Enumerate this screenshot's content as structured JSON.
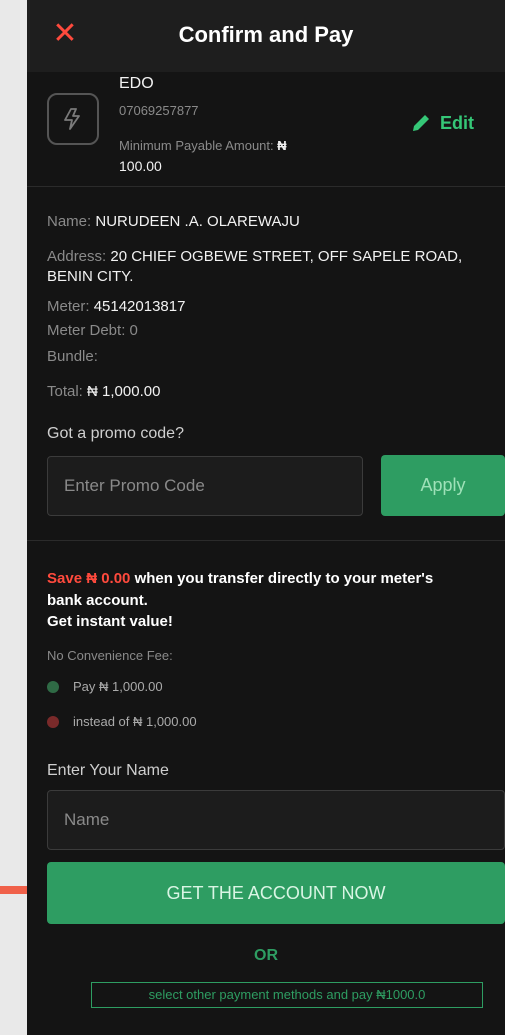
{
  "header": {
    "title": "Confirm and Pay",
    "close_icon": "close-icon"
  },
  "meter_card": {
    "disco": "EDO",
    "phone": "07069257877",
    "min_label": "Minimum Payable Amount:",
    "min_currency": "₦",
    "min_value": "100.00",
    "edit_label": "Edit"
  },
  "details": {
    "name_label": "Name:",
    "name_value": "NURUDEEN .A. OLAREWAJU",
    "address_label": "Address:",
    "address_value": "20 CHIEF OGBEWE STREET, OFF SAPELE ROAD,",
    "address_value_2": "BENIN CITY.",
    "meter_label": "Meter:",
    "meter_value": "45142013817",
    "debt_label": "Meter Debt:",
    "debt_value": "0",
    "bundle_label": "Bundle:",
    "total_label": "Total:",
    "total_value": "₦ 1,000.00"
  },
  "promo": {
    "question": "Got a promo code?",
    "placeholder": "Enter Promo Code",
    "apply_label": "Apply"
  },
  "transfer": {
    "save_text": "Save ₦ 0.00",
    "save_rest": " when you transfer directly to your meter's",
    "save_line2": "bank account.",
    "instant": "Get instant value!",
    "no_fee": "No Convenience Fee:",
    "pay_text": "Pay ₦ 1,000.00",
    "instead_text": "instead of ₦ 1,000.00"
  },
  "name_form": {
    "label": "Enter Your Name",
    "placeholder": "Name"
  },
  "cta_label": "GET THE ACCOUNT NOW",
  "or_label": "OR",
  "other_payment_label": "select other payment methods and pay ₦1000.0",
  "colors": {
    "accent": "#2e9d62",
    "danger": "#ff4a3d",
    "background": "#141414"
  }
}
